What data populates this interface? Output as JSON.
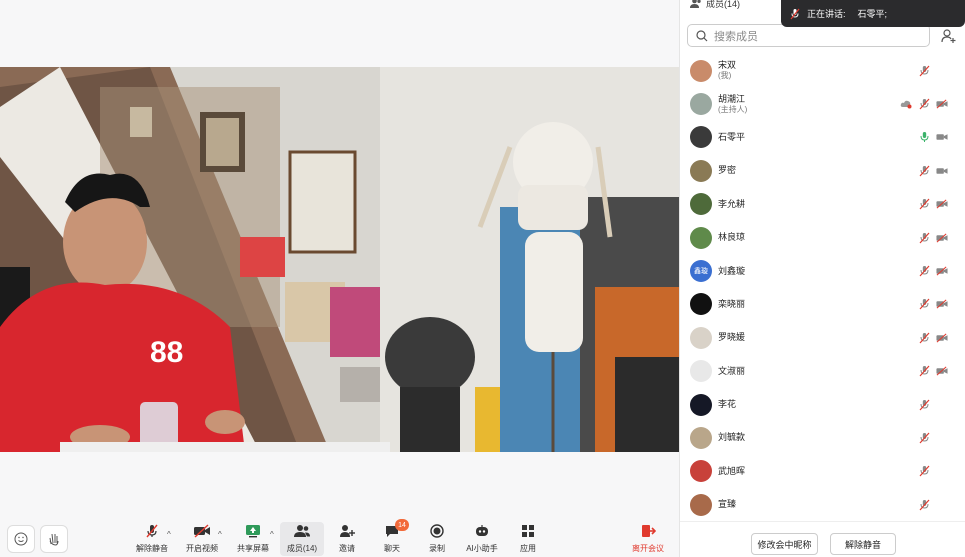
{
  "meeting": {
    "members_header": "成员(14)",
    "speaking_label": "正在讲话:",
    "speaking_name": "石零平;"
  },
  "toolbar": {
    "unmute": "解除静音",
    "start_video": "开启视频",
    "share": "共享屏幕",
    "members": "成员(14)",
    "invite": "邀请",
    "chat": "聊天",
    "chat_badge": "14",
    "record": "录制",
    "ai": "AI小助手",
    "apps": "应用",
    "leave": "离开会议"
  },
  "panel": {
    "search_placeholder": "搜索成员",
    "rename_button": "修改会中昵称",
    "unmute_button": "解除静音",
    "members": [
      {
        "name": "宋双",
        "role": "(我)",
        "avatar_color": "#c98b6a",
        "mic": "muted",
        "cam": "none"
      },
      {
        "name": "胡潮江",
        "role": "(主持人)",
        "avatar_color": "#9aa8a0",
        "mic": "muted",
        "cam": "off",
        "cloud": true
      },
      {
        "name": "石零平",
        "role": "",
        "avatar_color": "#3a3a3a",
        "mic": "on",
        "cam": "on"
      },
      {
        "name": "罗密",
        "role": "",
        "avatar_color": "#8a7a55",
        "mic": "muted",
        "cam": "on"
      },
      {
        "name": "李允耕",
        "role": "",
        "avatar_color": "#4e6a3a",
        "mic": "muted",
        "cam": "off"
      },
      {
        "name": "林良琼",
        "role": "",
        "avatar_color": "#5f8a4a",
        "mic": "muted",
        "cam": "off"
      },
      {
        "name": "刘鑫璇",
        "role": "",
        "avatar_color": "#3a6fd1",
        "avatar_text": "鑫璇",
        "mic": "muted",
        "cam": "off"
      },
      {
        "name": "栾晓丽",
        "role": "",
        "avatar_color": "#111111",
        "mic": "muted",
        "cam": "off"
      },
      {
        "name": "罗晓媛",
        "role": "",
        "avatar_color": "#d9d2c8",
        "mic": "muted",
        "cam": "off"
      },
      {
        "name": "文淑丽",
        "role": "",
        "avatar_color": "#e8e8e8",
        "mic": "muted",
        "cam": "off"
      },
      {
        "name": "李花",
        "role": "",
        "avatar_color": "#151826",
        "mic": "muted",
        "cam": "none"
      },
      {
        "name": "刘毓款",
        "role": "",
        "avatar_color": "#b9a68a",
        "mic": "muted",
        "cam": "none"
      },
      {
        "name": "武旭晖",
        "role": "",
        "avatar_color": "#c8413a",
        "mic": "muted",
        "cam": "none"
      },
      {
        "name": "宣臻",
        "role": "",
        "avatar_color": "#a86a4a",
        "mic": "muted",
        "cam": "none"
      }
    ]
  },
  "colors": {
    "accent_red": "#e03a2e",
    "mic_on_green": "#3bb36a",
    "badge_orange": "#f26a3a"
  }
}
